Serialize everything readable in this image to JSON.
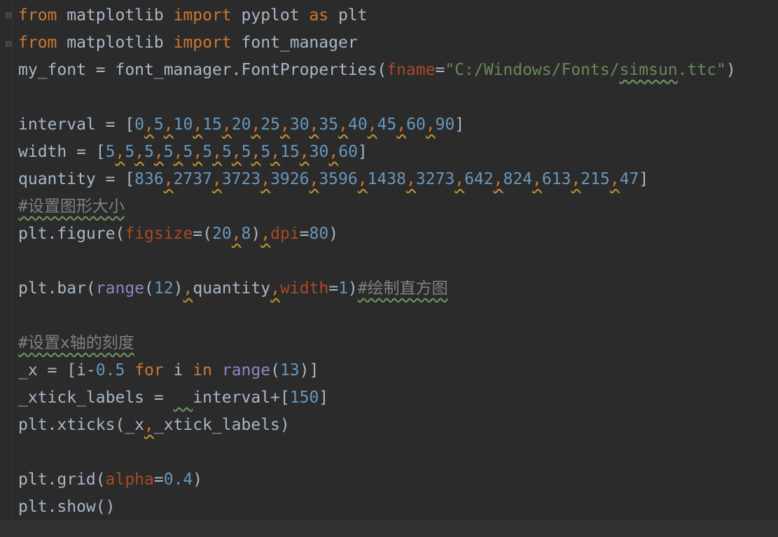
{
  "code": {
    "l1": {
      "kw1": "from",
      "mod": " matplotlib ",
      "kw2": "import",
      "name": " pyplot ",
      "kw3": "as",
      "alias": " plt"
    },
    "l2": {
      "kw1": "from",
      "mod": " matplotlib ",
      "kw2": "import",
      "name": " font_manager"
    },
    "l3": {
      "lhs": "my_font = font_manager.FontProperties(",
      "param": "fname",
      "eq": "=",
      "str1": "\"C:/Windows/Fonts/",
      "str_sq": "simsun",
      "str2": ".ttc\"",
      "rp": ")"
    },
    "l5": {
      "lhs": "interval = [",
      "nums": [
        "0",
        "5",
        "10",
        "15",
        "20",
        "25",
        "30",
        "35",
        "40",
        "45",
        "60",
        "90"
      ],
      "rb": "]"
    },
    "l6": {
      "lhs": "width = [",
      "nums": [
        "5",
        "5",
        "5",
        "5",
        "5",
        "5",
        "5",
        "5",
        "5",
        "15",
        "30",
        "60"
      ],
      "rb": "]"
    },
    "l7": {
      "lhs": "quantity = [",
      "nums": [
        "836",
        "2737",
        "3723",
        "3926",
        "3596",
        "1438",
        "3273",
        "642",
        "824",
        "613",
        "215",
        "47"
      ],
      "rb": "]"
    },
    "l8": {
      "text": "#设置图形大小"
    },
    "l9": {
      "a": "plt.figure(",
      "p1": "figsize",
      "eq": "=(",
      "n1": "20",
      "c": ",",
      "n2": "8",
      "rp": ")",
      "c2": ",",
      "p2": "dpi",
      "eq2": "=",
      "n3": "80",
      "end": ")"
    },
    "l11": {
      "a": "plt.bar(",
      "b": "range",
      "c": "(",
      "n1": "12",
      "d": ")",
      "c1": ",",
      "e": "quantity",
      "c2": ",",
      "p": "width",
      "eq": "=",
      "n2": "1",
      "f": ")",
      "cm": "#绘制直方图"
    },
    "l13": {
      "text": "#设置x轴的刻度"
    },
    "l14": {
      "a": "_x = [i-",
      "n1": "0.5",
      "sp": " ",
      "k1": "for",
      "b": " i ",
      "k2": "in",
      "sp2": " ",
      "r": "range",
      "c": "(",
      "n2": "13",
      "d": ")]"
    },
    "l15": {
      "a": "_xtick_labels = ",
      "sq": "  ",
      "b": "interval+[",
      "n": "150",
      "c": "]"
    },
    "l16": {
      "a": "plt.xticks(_x",
      "c": ",",
      "b": "_xtick_labels)"
    },
    "l18": {
      "a": "plt.grid(",
      "p": "alpha",
      "eq": "=",
      "n": "0.4",
      "b": ")"
    },
    "l19": {
      "text": "plt.show()"
    }
  },
  "colors": {
    "background": "#2b2b2b",
    "keyword": "#cc7832",
    "string": "#6a8759",
    "number": "#6897bb",
    "param": "#aa4926",
    "builtin": "#8888c6",
    "comment": "#808080"
  }
}
